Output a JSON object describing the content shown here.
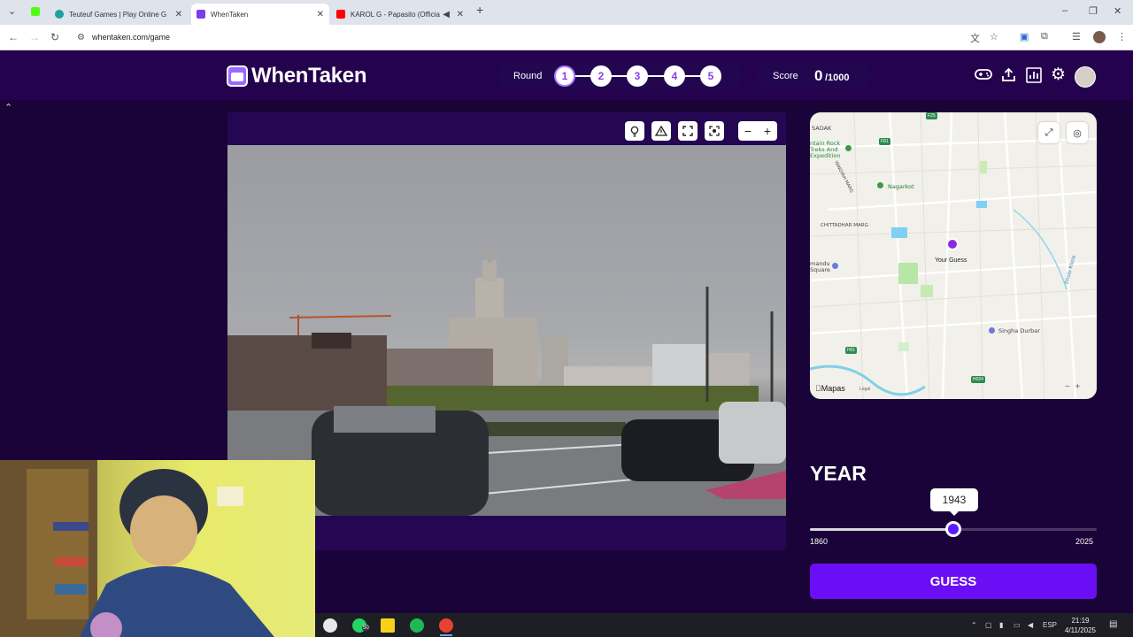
{
  "browser": {
    "tabs": [
      {
        "title": "Teuteuf Games | Play Online G",
        "active": false
      },
      {
        "title": "WhenTaken",
        "active": true
      },
      {
        "title": "KAROL G - Papasito (Officia",
        "active": false
      }
    ],
    "url": "whentaken.com/game"
  },
  "app": {
    "logo_text": "WhenTaken",
    "round_label": "Round",
    "rounds": [
      "1",
      "2",
      "3",
      "4",
      "5"
    ],
    "current_round": "1",
    "score_label": "Score",
    "score_value": "0",
    "score_max": "/1000"
  },
  "map": {
    "pin_label": "Your Guess",
    "labels": {
      "sadak": "SADAK",
      "fontain": "ntain Rock",
      "treks": "Treks And",
      "expedition": "Expedition",
      "nagarkot": "Nagarkot",
      "yangyah": "YANGYAH MARG",
      "chittadhar": "CHITTADHAR MARG",
      "mandu": "mandu",
      "square": "Square",
      "singha": "Singha Durbar",
      "dhobi": "Dhobi Khola"
    },
    "roads": {
      "f25": "F25",
      "f81": "F81",
      "h01": "H01",
      "h024": "H024"
    },
    "logo": "Mapas",
    "legal": "Legal"
  },
  "year": {
    "title": "YEAR",
    "value": "1943",
    "min": "1860",
    "max": "2025",
    "fraction": 0.5
  },
  "guess_label": "GUESS",
  "taskbar": {
    "badge": "50",
    "lang": "ESP",
    "time": "21:19",
    "date": "4/11/2025"
  },
  "colors": {
    "background": "#1a0338",
    "accent": "#6a0ff5",
    "pin": "#8a2be2"
  }
}
